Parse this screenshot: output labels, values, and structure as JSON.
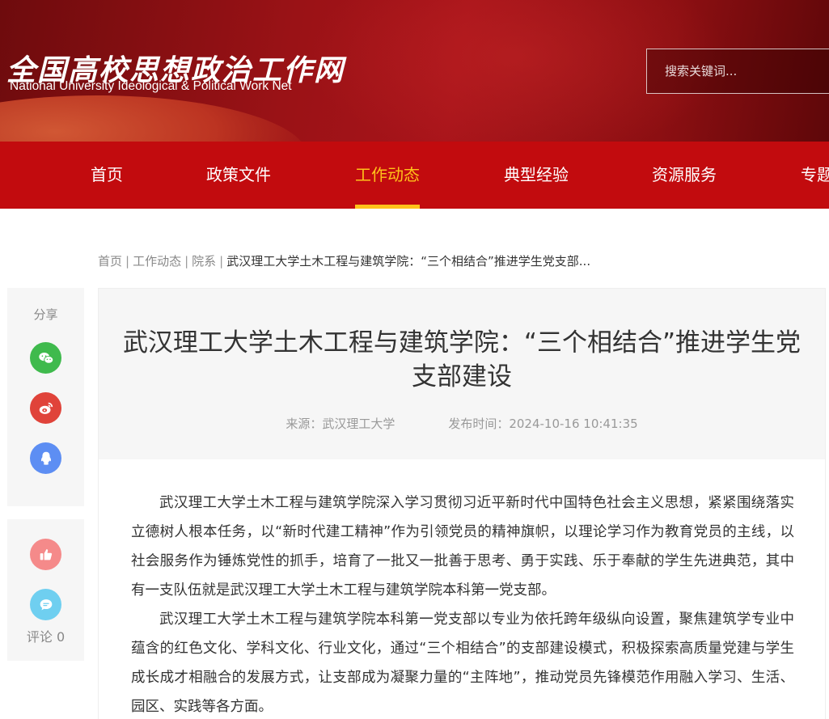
{
  "site": {
    "logo_cn": "全国高校思想政治工作网",
    "logo_en": "National University Ideological & Political Work Net"
  },
  "search": {
    "placeholder": "搜索关键词..."
  },
  "nav": {
    "items": [
      {
        "label": "首页"
      },
      {
        "label": "政策文件"
      },
      {
        "label": "工作动态"
      },
      {
        "label": "典型经验"
      },
      {
        "label": "资源服务"
      },
      {
        "label": "专题"
      }
    ],
    "active": "工作动态"
  },
  "breadcrumb": {
    "home": "首页",
    "level1": "工作动态",
    "level2": "院系",
    "current": "武汉理工大学土木工程与建筑学院：“三个相结合”推进学生党支部...",
    "separator": "|"
  },
  "share": {
    "label": "分享",
    "icons": [
      "wechat-icon",
      "weibo-icon",
      "qq-icon"
    ]
  },
  "actions": {
    "comment_label": "评论 0",
    "icons": [
      "like-icon",
      "comment-icon"
    ]
  },
  "article": {
    "title": "武汉理工大学土木工程与建筑学院：“三个相结合”推进学生党支部建设",
    "source": "来源：武汉理工大学",
    "published": "发布时间：2024-10-16 10:41:35",
    "paragraphs": [
      "武汉理工大学土木工程与建筑学院深入学习贯彻习近平新时代中国特色社会主义思想，紧紧围绕落实立德树人根本任务，以“新时代建工精神”作为引领党员的精神旗帜，以理论学习作为教育党员的主线，以社会服务作为锤炼党性的抓手，培育了一批又一批善于思考、勇于实践、乐于奉献的学生先进典范，其中有一支队伍就是武汉理工大学土木工程与建筑学院本科第一党支部。",
      "武汉理工大学土木工程与建筑学院本科第一党支部以专业为依托跨年级纵向设置，聚焦建筑学专业中蕴含的红色文化、学科文化、行业文化，通过“三个相结合”的支部建设模式，积极探索高质量党建与学生成长成才相融合的发展方式，让支部成为凝聚力量的“主阵地”，推动党员先锋模范作用融入学习、生活、园区、实践等各方面。"
    ]
  },
  "colors": {
    "nav_bg": "#c20b0e",
    "active": "#ffc21a",
    "header_bg": "#9a1216"
  }
}
